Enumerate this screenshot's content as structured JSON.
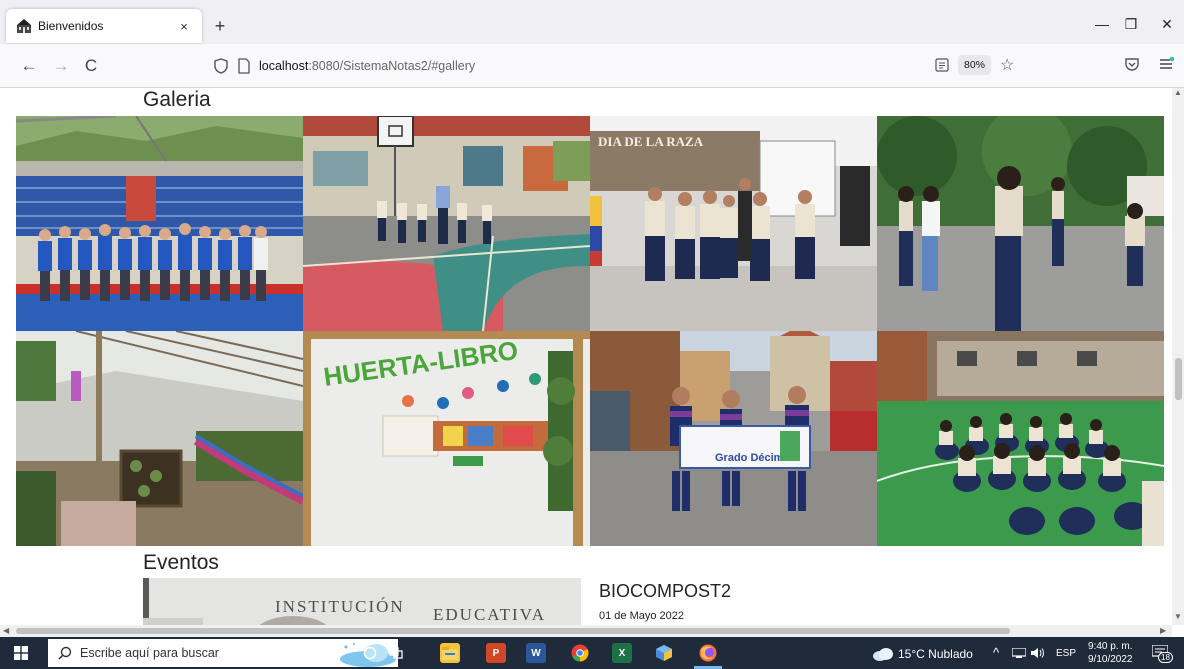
{
  "browser": {
    "tab_title": "Bienvenidos",
    "tab_close": "×",
    "new_tab": "+",
    "url_host": "localhost",
    "url_rest": ":8080/SistemaNotas2/#gallery",
    "zoom_label": "80%",
    "nav_back": "←",
    "nav_forward": "→",
    "nav_reload": "C",
    "win_minimize": "—",
    "win_restore": "❐",
    "win_close": "✕",
    "star": "☆"
  },
  "page": {
    "gallery_title": "Galeria",
    "events_title": "Eventos",
    "event": {
      "title": "BIOCOMPOST2",
      "date": "01 de Mayo 2022",
      "image_text_line1": "INSTITUCIÓN",
      "image_text_line2": "EDUCATIVA"
    },
    "photos": [
      {
        "icon": "group-photo-stadium",
        "caption": ""
      },
      {
        "icon": "basketball-court-photo"
      },
      {
        "icon": "stage-dia-de-la-raza-photo",
        "banner": "DIA DE LA RAZA"
      },
      {
        "icon": "schoolyard-game-photo"
      },
      {
        "icon": "greenhouse-photo"
      },
      {
        "icon": "huerta-libro-wall-photo",
        "mural": "HUERTA-LIBRO"
      },
      {
        "icon": "parade-grado-decimo-photo",
        "banner": "Grado Décimo"
      },
      {
        "icon": "students-seated-photo"
      }
    ]
  },
  "taskbar": {
    "search_placeholder": "Escribe aquí para buscar",
    "weather": "15°C  Nublado",
    "language": "ESP",
    "time": "9:40 p. m.",
    "date": "9/10/2022",
    "notifications": "18"
  },
  "colors": {
    "accent": "#0060df",
    "taskbar": "#1f2b3a",
    "tab_strip": "#f0f0f4"
  }
}
